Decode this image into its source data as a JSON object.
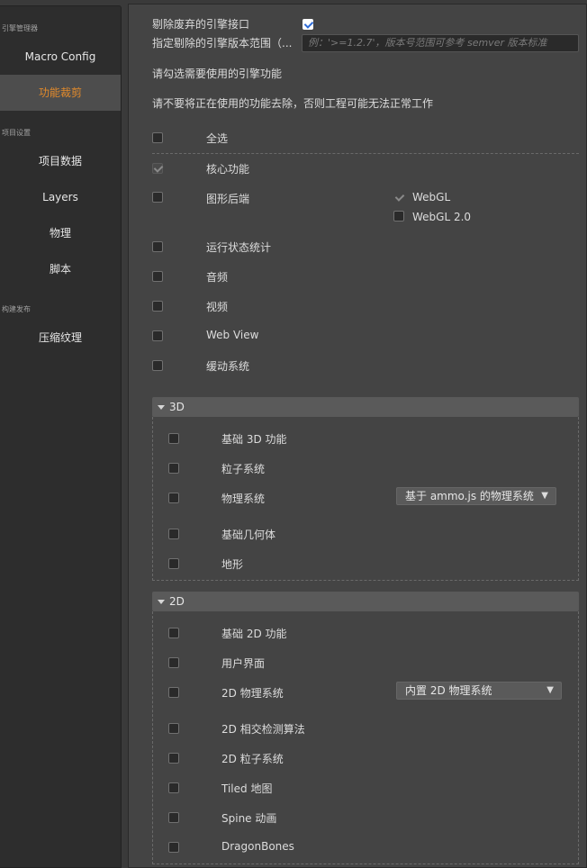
{
  "sidebar": {
    "sections": [
      {
        "label": "引擎管理器",
        "items": [
          "Macro Config",
          "功能裁剪"
        ]
      },
      {
        "label": "项目设置",
        "items": [
          "项目数据",
          "Layers",
          "物理",
          "脚本"
        ]
      },
      {
        "label": "构建发布",
        "items": [
          "压缩纹理"
        ]
      }
    ],
    "active_item": "功能裁剪"
  },
  "settings": {
    "remove_deprecated_label": "剔除废弃的引擎接口",
    "remove_deprecated_checked": true,
    "version_range_label": "指定剔除的引擎版本范围（...",
    "version_range_placeholder": "例：'>=1.2.7'，版本号范围可参考 semver 版本标准",
    "instruction_1": "请勾选需要使用的引擎功能",
    "instruction_2": "请不要将正在使用的功能去除，否则工程可能无法正常工作"
  },
  "features": {
    "select_all": "全选",
    "core": "核心功能",
    "graphics_backend": "图形后端",
    "webgl": "WebGL",
    "webgl2": "WebGL 2.0",
    "profiler": "运行状态统计",
    "audio": "音频",
    "video": "视频",
    "webview": "Web View",
    "tween": "缓动系统"
  },
  "group_3d": {
    "title": "3D",
    "items": [
      "基础 3D 功能",
      "粒子系统",
      "物理系统",
      "基础几何体",
      "地形"
    ],
    "physics_select": "基于 ammo.js 的物理系统"
  },
  "group_2d": {
    "title": "2D",
    "items": [
      "基础 2D 功能",
      "用户界面",
      "2D 物理系统",
      "2D 相交检测算法",
      "2D 粒子系统",
      "Tiled 地图",
      "Spine 动画",
      "DragonBones"
    ],
    "physics_select": "内置 2D 物理系统"
  },
  "colors": {
    "accent": "#e28a2b",
    "check_blue": "#2e6bd6",
    "panel_bg": "#444444",
    "sidebar_bg": "#2d2d2d"
  }
}
